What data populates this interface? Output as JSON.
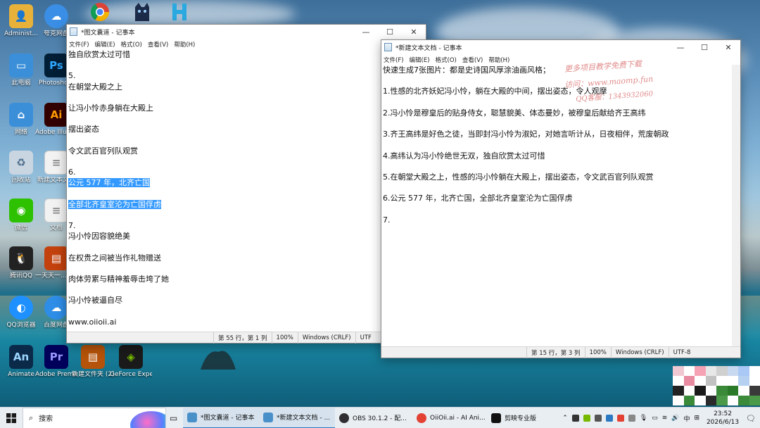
{
  "desktop": {
    "icons": [
      {
        "label": "Administ...",
        "icon": "user-folder-icon",
        "color": "#e8b23a"
      },
      {
        "label": "此电脑",
        "icon": "computer-icon",
        "color": "#3b8fd9"
      },
      {
        "label": "网络",
        "icon": "network-icon",
        "color": "#3b8fd9"
      },
      {
        "label": "回收站",
        "icon": "recycle-bin-icon",
        "color": "#c9d6e2"
      },
      {
        "label": "微信",
        "icon": "wechat-icon",
        "color": "#2dc100"
      },
      {
        "label": "腾讯QQ",
        "icon": "qq-icon",
        "color": "#222222"
      },
      {
        "label": "QQ浏览器",
        "icon": "qq-browser-icon",
        "color": "#1e90ff"
      },
      {
        "label": "Animate",
        "icon": "animate-icon",
        "color": "#0b2a4a",
        "text": "An"
      }
    ],
    "icons_col2": [
      {
        "label": "夸克网盘",
        "icon": "quark-icon",
        "color": "#3a8ee6"
      },
      {
        "label": "Photosho...",
        "icon": "photoshop-icon",
        "color": "#001e36",
        "text": "Ps"
      },
      {
        "label": "Adobe Illustrat...",
        "icon": "illustrator-icon",
        "color": "#330000",
        "text": "Ai"
      },
      {
        "label": "新建文本文档",
        "icon": "text-file-icon",
        "color": "#f2f2f2"
      },
      {
        "label": "文档",
        "icon": "document-icon",
        "color": "#f2f2f2"
      },
      {
        "label": "一天天一...的文档",
        "icon": "archive-icon",
        "color": "#c2410c"
      },
      {
        "label": "百度网盘",
        "icon": "baidu-netdisk-icon",
        "color": "#2e8de6"
      },
      {
        "label": "Adobe Premie...",
        "icon": "premiere-icon",
        "color": "#00005b",
        "text": "Pr"
      }
    ],
    "icons_row_bottom": [
      {
        "label": "新建文件夹 (2)",
        "icon": "archive-icon",
        "color": "#b45309"
      },
      {
        "label": "GeForce Experience",
        "icon": "geforce-icon",
        "color": "#76b900"
      }
    ],
    "top_icons": [
      {
        "icon": "chrome-icon"
      },
      {
        "icon": "cat-app-icon"
      },
      {
        "icon": "h-app-icon"
      }
    ]
  },
  "notepad1": {
    "title": "*图文囊道 - 记事本",
    "menu": [
      "文件(F)",
      "编辑(E)",
      "格式(O)",
      "查看(V)",
      "帮助(H)"
    ],
    "lines": [
      "独自欣赏太过可惜",
      "",
      "5.",
      "在朝堂大殿之上",
      "",
      "让冯小怜赤身躺在大殿上",
      "",
      "摆出姿态",
      "",
      "令文武百官列队观赏",
      "",
      "6.",
      "公元 577 年，北齐亡国",
      "",
      "全部北齐皇室沦为亡国俘虏",
      "",
      "7.",
      "冯小怜因容貌绝美",
      "",
      "在权贵之间被当作礼物赠送",
      "",
      "肉体劳累与精神羞辱击垮了她",
      "",
      "冯小怜被逼自尽",
      "",
      "www.oiioii.ai"
    ],
    "selected_lines": [
      12,
      14
    ],
    "status": {
      "position": "第 55 行，第 1 列",
      "zoom": "100%",
      "eol": "Windows (CRLF)",
      "encoding": "UTF"
    }
  },
  "notepad2": {
    "title": "*新建文本文档 - 记事本",
    "menu": [
      "文件(F)",
      "编辑(E)",
      "格式(O)",
      "查看(V)",
      "帮助(H)"
    ],
    "lines": [
      "快速生成7张图片：都是史诗国风厚涂油画风格；",
      "",
      "1.性感的北齐妖妃冯小怜，躺在大殿的中间，摆出姿态，令人观摩",
      "",
      "2.冯小怜是穆皇后的贴身侍女，聪慧貌美、体态曼妙，被穆皇后献给齐王高纬",
      "",
      "3.齐王高纬是好色之徒，当即封冯小怜为淑妃，对她言听计从，日夜相伴，荒废朝政",
      "",
      "4.高纬认为冯小怜绝世无双，独自欣赏太过可惜",
      "",
      "5.在朝堂大殿之上，性感的冯小怜躺在大殿上，摆出姿态，令文武百官列队观赏",
      "",
      "6.公元 577 年，北齐亡国，全部北齐皇室沦为亡国俘虏",
      "",
      "7."
    ],
    "status": {
      "position": "第 15 行，第 3 列",
      "zoom": "100%",
      "eol": "Windows (CRLF)",
      "encoding": "UTF-8"
    }
  },
  "watermark": {
    "line1": "更多项目教学免费下载",
    "line2": "访问：www.maomp.fun",
    "line3": "QQ客服：1343932060"
  },
  "taskbar": {
    "search_placeholder": "搜索",
    "apps": [
      {
        "label": "*图文囊道 - 记事本",
        "icon": "notepad-icon",
        "color": "#4a90c8",
        "active": true
      },
      {
        "label": "*新建文本文档 - ...",
        "icon": "notepad-icon",
        "color": "#4a90c8",
        "active": true
      },
      {
        "label": "OBS 30.1.2 - 配...",
        "icon": "obs-icon",
        "color": "#302e31",
        "active": false
      },
      {
        "label": "OiiOii.ai - AI Ani...",
        "icon": "chrome-icon",
        "color": "#e34133",
        "active": false
      },
      {
        "label": "剪映专业版",
        "icon": "capcut-icon",
        "color": "#111111",
        "active": false
      }
    ],
    "tray": {
      "ime": "中",
      "time": "23:52",
      "date": "2026/6/13"
    }
  }
}
